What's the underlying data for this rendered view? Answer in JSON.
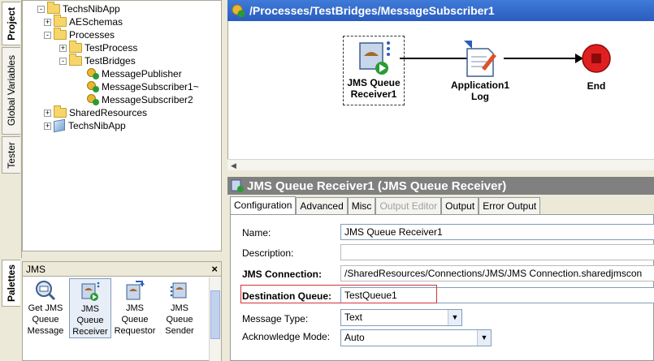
{
  "left_tabs": [
    "Project",
    "Global Variables",
    "Tester"
  ],
  "tree": [
    {
      "label": "TechsNibApp",
      "icon": "folder-icon",
      "expander": "-"
    },
    {
      "label": "AESchemas",
      "icon": "folder-icon",
      "expander": "+"
    },
    {
      "label": "Processes",
      "icon": "folder-icon",
      "expander": "-"
    },
    {
      "label": "TestProcess",
      "icon": "folder-icon",
      "expander": "+"
    },
    {
      "label": "TestBridges",
      "icon": "folder-icon",
      "expander": "-"
    },
    {
      "label": "MessagePublisher",
      "icon": "process-icon",
      "expander": ""
    },
    {
      "label": "MessageSubscriber1~",
      "icon": "process-icon",
      "expander": ""
    },
    {
      "label": "MessageSubscriber2",
      "icon": "process-icon",
      "expander": ""
    },
    {
      "label": "SharedResources",
      "icon": "folder-icon",
      "expander": "+"
    },
    {
      "label": "TechsNibApp",
      "icon": "cube-icon",
      "expander": "+"
    }
  ],
  "palettes": {
    "tab_label": "Palettes",
    "header": "JMS",
    "close": "×",
    "items": [
      {
        "label": "Get JMS Queue Message"
      },
      {
        "label": "JMS Queue Receiver"
      },
      {
        "label": "JMS Queue Requestor"
      },
      {
        "label": "JMS Queue Sender"
      }
    ]
  },
  "canvas": {
    "title": "/Processes/TestBridges/MessageSubscriber1",
    "nodes": [
      {
        "label": "JMS Queue Receiver1"
      },
      {
        "label": "Application1 Log"
      },
      {
        "label": "End"
      }
    ]
  },
  "properties": {
    "title": "JMS Queue Receiver1 (JMS Queue Receiver)",
    "tabs": [
      "Configuration",
      "Advanced",
      "Misc",
      "Output Editor",
      "Output",
      "Error Output"
    ],
    "fields": {
      "name_label": "Name:",
      "name_value": "JMS Queue Receiver1",
      "description_label": "Description:",
      "description_value": "",
      "connection_label": "JMS Connection:",
      "connection_value": "/SharedResources/Connections/JMS/JMS Connection.sharedjmscon",
      "queue_label": "Destination Queue:",
      "queue_value": "TestQueue1",
      "msgtype_label": "Message Type:",
      "msgtype_value": "Text",
      "ackmode_label": "Acknowledge Mode:",
      "ackmode_value": "Auto"
    }
  },
  "colors": {
    "title_bar": "#2a5cbf",
    "props_title": "#808080",
    "highlight": "#d6303a"
  }
}
